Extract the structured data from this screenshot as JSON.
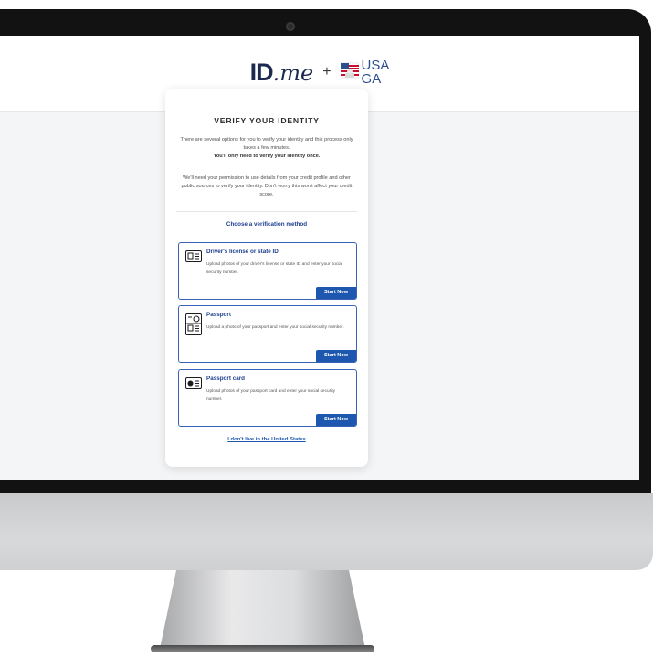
{
  "logo": {
    "id_text": "ID",
    "me_text": ".me",
    "plus": "+",
    "partner_line1": "USA",
    "partner_line2": "GA"
  },
  "card": {
    "title": "VERIFY YOUR IDENTITY",
    "para1": "There are several options for you to verify your identity and this process only takes a few minutes.",
    "para1_bold": "You'll only need to verify your identity once.",
    "para2": "We'll need your permission to use details from your credit profile and other public sources to verify your identity. Don't worry this won't affect your credit score.",
    "choose": "Choose a verification method",
    "options": [
      {
        "title": "Driver's license or state ID",
        "desc": "Upload photos of your driver's license or state ID and enter your social security number.",
        "button": "Start Now",
        "icon": "id-card-icon"
      },
      {
        "title": "Passport",
        "desc": "Upload a photo of your passport and enter your social security number.",
        "button": "Start Now",
        "icon": "passport-icon"
      },
      {
        "title": "Passport card",
        "desc": "Upload photos of your passport card and enter your social security number.",
        "button": "Start Now",
        "icon": "passport-card-icon"
      }
    ],
    "not_us_link": "I don't live in the United States"
  },
  "colors": {
    "accent": "#1d57b0",
    "heading_blue": "#1d3f8f",
    "bezel": "#121212"
  }
}
